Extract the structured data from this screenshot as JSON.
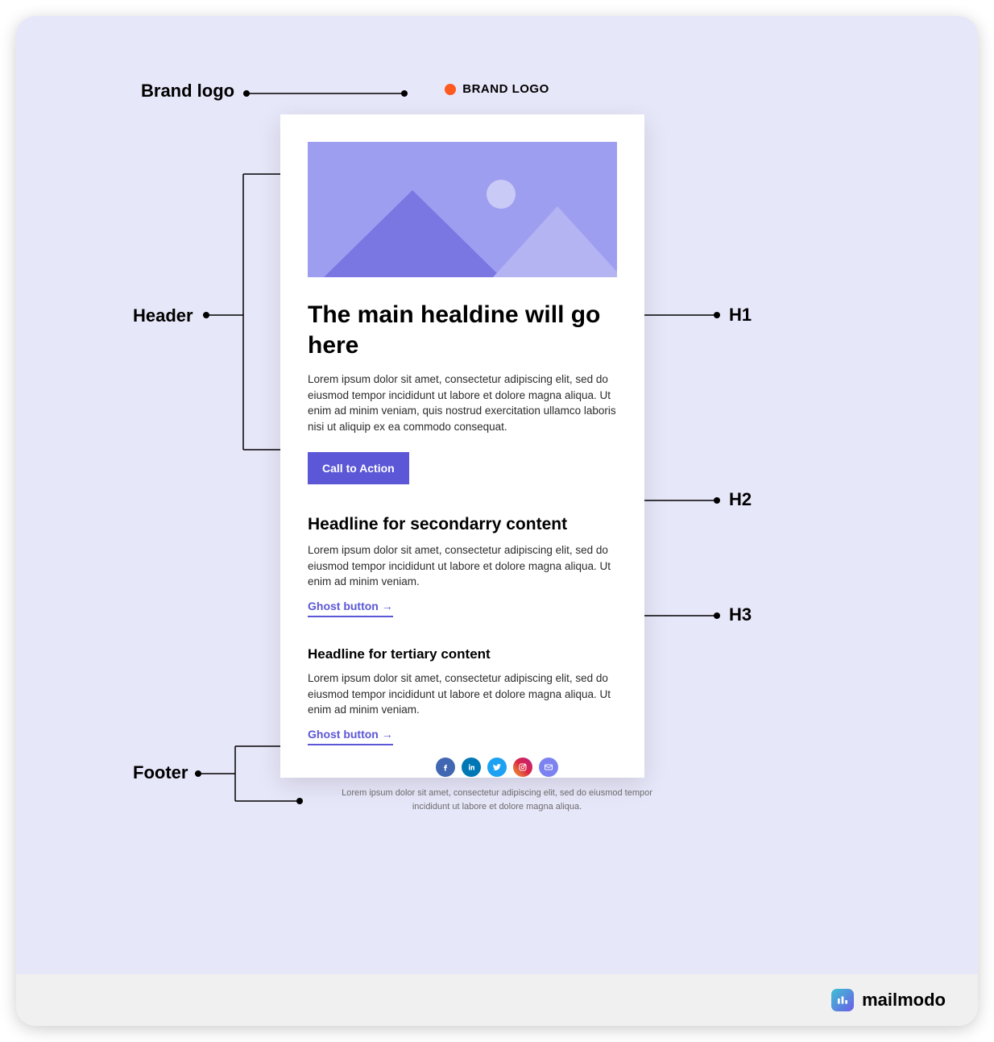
{
  "annotations": {
    "brandlogo": "Brand logo",
    "header": "Header",
    "footer": "Footer",
    "h1": "H1",
    "h2": "H2",
    "h3": "H3"
  },
  "brand": {
    "name": "BRAND LOGO"
  },
  "email": {
    "h1": "The main healdine will go here",
    "body1": "Lorem ipsum dolor sit amet, consectetur adipiscing elit, sed do eiusmod tempor incididunt ut labore et dolore magna aliqua. Ut enim ad minim veniam, quis nostrud exercitation ullamco laboris nisi ut aliquip ex ea commodo consequat.",
    "cta": "Call to Action",
    "h2": "Headline for secondarry content",
    "body2": "Lorem ipsum dolor sit amet, consectetur adipiscing elit, sed do eiusmod tempor incididunt ut labore et dolore magna aliqua. Ut enim ad minim veniam.",
    "ghost1": "Ghost button →",
    "h3": "Headline for tertiary content",
    "body3": "Lorem ipsum dolor sit amet, consectetur adipiscing elit, sed do eiusmod tempor incididunt ut labore et dolore magna aliqua. Ut enim ad minim veniam.",
    "ghost2": "Ghost button →"
  },
  "footer": {
    "text": "Lorem ipsum dolor sit amet, consectetur adipiscing elit, sed do eiusmod tempor incididunt ut labore et dolore magna aliqua."
  },
  "brandbar": {
    "name": "mailmodo"
  }
}
